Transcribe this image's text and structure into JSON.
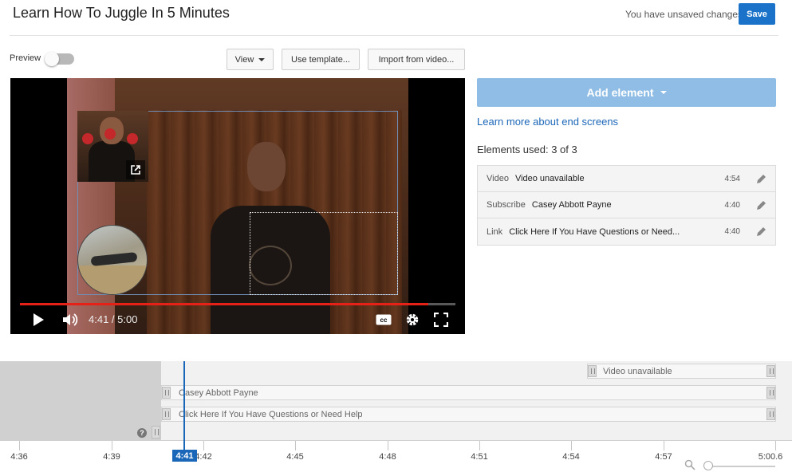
{
  "header": {
    "title": "Learn How To Juggle In 5 Minutes",
    "unsaved_text": "You have unsaved changes",
    "save_label": "Save"
  },
  "toolbar": {
    "preview_label": "Preview",
    "preview_on": false,
    "view_label": "View",
    "template_label": "Use template...",
    "import_label": "Import from video..."
  },
  "player": {
    "time": "4:41 / 5:00",
    "progress_fraction": 0.937,
    "progress_color": "#e62117"
  },
  "panel": {
    "add_element_label": "Add element",
    "learn_more": "Learn more about end screens",
    "elements_used": "Elements used: 3 of 3",
    "elements": [
      {
        "type": "Video",
        "name": "Video unavailable",
        "time": "4:54"
      },
      {
        "type": "Subscribe",
        "name": "Casey Abbott Payne",
        "time": "4:40"
      },
      {
        "type": "Link",
        "name": "Click Here If You Have Questions or Need...",
        "time": "4:40"
      }
    ]
  },
  "timeline": {
    "tracks": [
      {
        "label": "Video unavailable"
      },
      {
        "label": "Casey Abbott Payne"
      },
      {
        "label": "Click Here If You Have Questions or Need Help"
      }
    ],
    "ticks": [
      "4:36",
      "4:39",
      "4:42",
      "4:45",
      "4:48",
      "4:51",
      "4:54",
      "4:57",
      "5:00.6"
    ],
    "playhead_label": "4:41",
    "help_glyph": "?"
  },
  "colors": {
    "accent": "#1a73c9",
    "link": "#1a66b8",
    "add_element_bg": "#8fbde5"
  }
}
